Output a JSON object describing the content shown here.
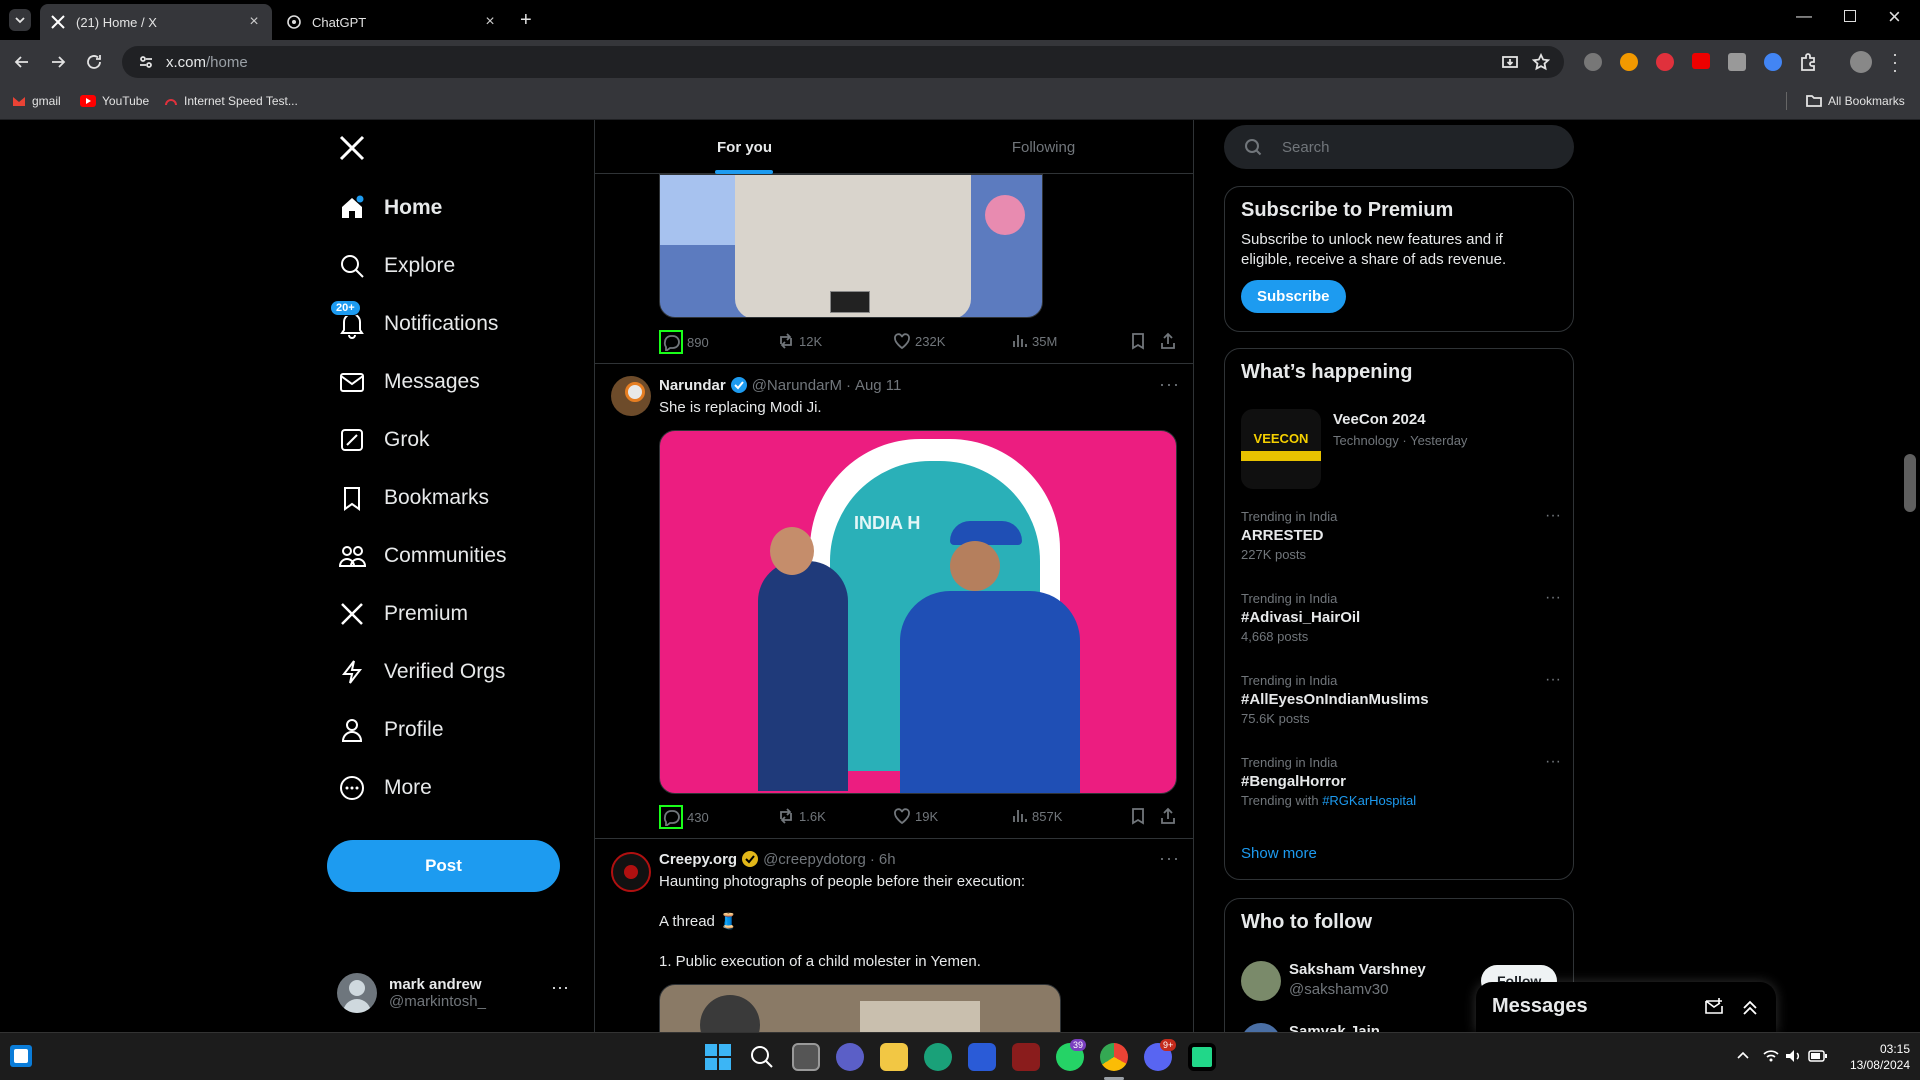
{
  "browser": {
    "tabs": [
      {
        "title": "(21) Home / X",
        "active": true
      },
      {
        "title": "ChatGPT",
        "active": false
      }
    ],
    "url_host": "x.com",
    "url_path": "/home",
    "bookmarks": [
      "gmail",
      "YouTube",
      "Internet Speed Test..."
    ],
    "all_bookmarks": "All Bookmarks"
  },
  "sidebar": {
    "items": [
      {
        "label": "Home",
        "icon": "home-icon"
      },
      {
        "label": "Explore",
        "icon": "search-icon"
      },
      {
        "label": "Notifications",
        "icon": "bell-icon",
        "badge": "20+"
      },
      {
        "label": "Messages",
        "icon": "mail-icon"
      },
      {
        "label": "Grok",
        "icon": "grok-icon"
      },
      {
        "label": "Bookmarks",
        "icon": "bookmark-icon"
      },
      {
        "label": "Communities",
        "icon": "communities-icon"
      },
      {
        "label": "Premium",
        "icon": "x-logo-icon"
      },
      {
        "label": "Verified Orgs",
        "icon": "lightning-icon"
      },
      {
        "label": "Profile",
        "icon": "person-icon"
      },
      {
        "label": "More",
        "icon": "more-circle-icon"
      }
    ],
    "post_button": "Post",
    "account": {
      "name": "mark andrew",
      "handle": "@markintosh_"
    }
  },
  "feed": {
    "tabs": [
      "For you",
      "Following"
    ],
    "tweets": [
      {
        "actions": {
          "replies": "890",
          "reposts": "12K",
          "likes": "232K",
          "views": "35M"
        }
      },
      {
        "name": "Narundar",
        "handle": "@NarundarM",
        "time": "Aug 11",
        "text": "She is replacing Modi Ji.",
        "image_text": "INDIA H",
        "actions": {
          "replies": "430",
          "reposts": "1.6K",
          "likes": "19K",
          "views": "857K"
        }
      },
      {
        "name": "Creepy.org",
        "handle": "@creepydotorg",
        "time": "6h",
        "lines": [
          "Haunting photographs of people before their execution:",
          "A thread 🧵",
          "1. Public execution of a child molester in Yemen."
        ]
      }
    ]
  },
  "right": {
    "search_placeholder": "Search",
    "premium": {
      "title": "Subscribe to Premium",
      "body": "Subscribe to unlock new features and if eligible, receive a share of ads revenue.",
      "button": "Subscribe"
    },
    "happening": {
      "title": "What’s happening",
      "event": {
        "name": "VeeCon 2024",
        "meta": "Technology · Yesterday",
        "logo_text": "VEECON"
      },
      "trends": [
        {
          "category": "Trending in India",
          "name": "ARRESTED",
          "posts": "227K posts"
        },
        {
          "category": "Trending in India",
          "name": "#Adivasi_HairOil",
          "posts": "4,668 posts"
        },
        {
          "category": "Trending in India",
          "name": "#AllEyesOnIndianMuslims",
          "posts": "75.6K posts"
        },
        {
          "category": "Trending in India",
          "name": "#BengalHorror",
          "posts_prefix": "Trending with",
          "posts_link": "#RGKarHospital"
        }
      ],
      "show_more": "Show more"
    },
    "who_to_follow": {
      "title": "Who to follow",
      "users": [
        {
          "name": "Saksham Varshney",
          "handle": "@sakshamv30",
          "button": "Follow"
        },
        {
          "name": "Samyak Jain"
        }
      ]
    },
    "messages_drawer": "Messages"
  },
  "taskbar": {
    "time": "03:15",
    "date": "13/08/2024",
    "badges": {
      "whatsapp": "39",
      "discord": "9+"
    }
  },
  "colors": {
    "accent": "#1d9bf0",
    "bg": "#000000",
    "border": "#2f3336",
    "muted": "#71767b"
  }
}
